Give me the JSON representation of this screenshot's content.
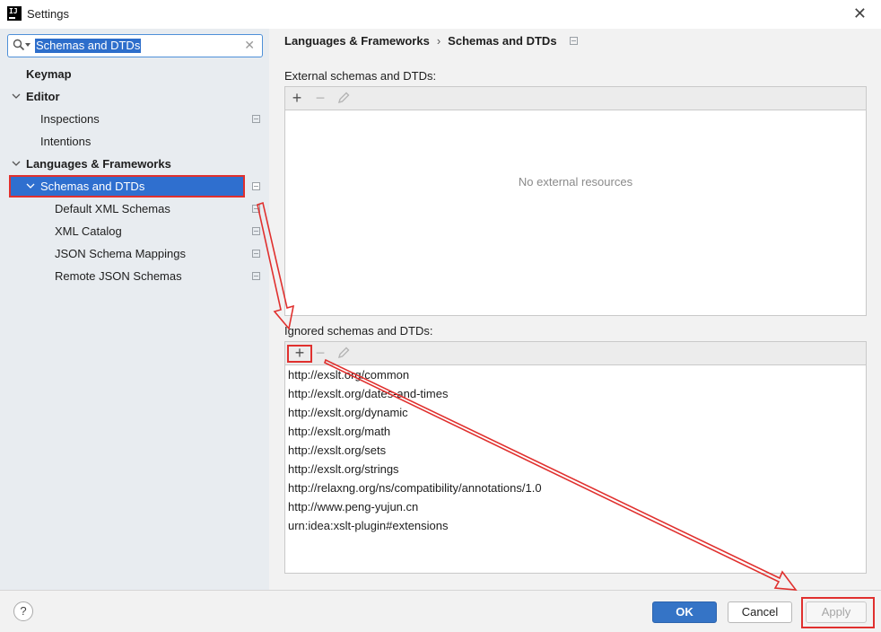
{
  "window": {
    "title": "Settings",
    "app_icon_text": "IJ"
  },
  "search": {
    "value": "Schemas and DTDs"
  },
  "tree": [
    {
      "label": "Keymap"
    },
    {
      "label": "Editor"
    },
    {
      "label": "Inspections"
    },
    {
      "label": "Intentions"
    },
    {
      "label": "Languages & Frameworks"
    },
    {
      "label": "Schemas and DTDs"
    },
    {
      "label": "Default XML Schemas"
    },
    {
      "label": "XML Catalog"
    },
    {
      "label": "JSON Schema Mappings"
    },
    {
      "label": "Remote JSON Schemas"
    }
  ],
  "breadcrumb": {
    "parent": "Languages & Frameworks",
    "separator": "›",
    "current": "Schemas and DTDs"
  },
  "external": {
    "label": "External schemas and DTDs:",
    "empty": "No external resources"
  },
  "ignored": {
    "label": "Ignored schemas and DTDs:",
    "items": [
      "http://exslt.org/common",
      "http://exslt.org/dates-and-times",
      "http://exslt.org/dynamic",
      "http://exslt.org/math",
      "http://exslt.org/sets",
      "http://exslt.org/strings",
      "http://relaxng.org/ns/compatibility/annotations/1.0",
      "http://www.peng-yujun.cn",
      "urn:idea:xslt-plugin#extensions"
    ]
  },
  "toolbar": {
    "add": "+",
    "remove": "−"
  },
  "buttons": {
    "help": "?",
    "ok": "OK",
    "cancel": "Cancel",
    "apply": "Apply"
  },
  "colors": {
    "accent": "#2f6fcf",
    "annotation": "#e0302e"
  }
}
